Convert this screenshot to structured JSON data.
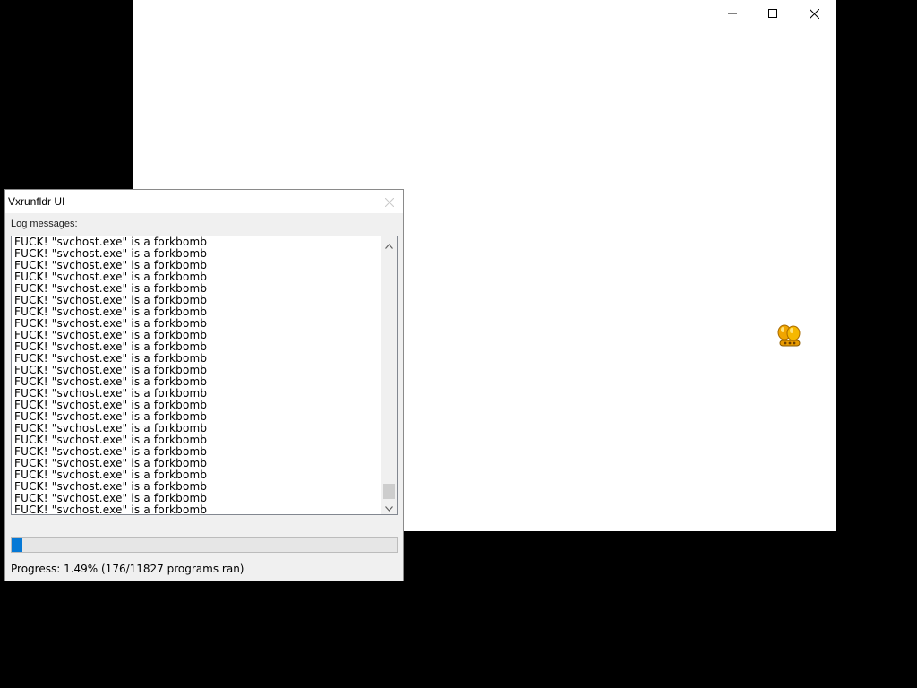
{
  "background_window": {
    "controls": {
      "minimize_icon": "minimize-icon",
      "maximize_icon": "maximize-icon",
      "close_icon": "close-icon"
    },
    "app_icon": "gold-bells-icon"
  },
  "vx_window": {
    "title": "Vxrunfldr UI",
    "close_icon": "close-icon",
    "log_label": "Log messages:",
    "log_lines": [
      "FUCK! \"svchost.exe\" is a forkbomb",
      "FUCK! \"svchost.exe\" is a forkbomb",
      "FUCK! \"svchost.exe\" is a forkbomb",
      "FUCK! \"svchost.exe\" is a forkbomb",
      "FUCK! \"svchost.exe\" is a forkbomb",
      "FUCK! \"svchost.exe\" is a forkbomb",
      "FUCK! \"svchost.exe\" is a forkbomb",
      "FUCK! \"svchost.exe\" is a forkbomb",
      "FUCK! \"svchost.exe\" is a forkbomb",
      "FUCK! \"svchost.exe\" is a forkbomb",
      "FUCK! \"svchost.exe\" is a forkbomb",
      "FUCK! \"svchost.exe\" is a forkbomb",
      "FUCK! \"svchost.exe\" is a forkbomb",
      "FUCK! \"svchost.exe\" is a forkbomb",
      "FUCK! \"svchost.exe\" is a forkbomb",
      "FUCK! \"svchost.exe\" is a forkbomb",
      "FUCK! \"svchost.exe\" is a forkbomb",
      "FUCK! \"svchost.exe\" is a forkbomb",
      "FUCK! \"svchost.exe\" is a forkbomb",
      "FUCK! \"svchost.exe\" is a forkbomb",
      "FUCK! \"svchost.exe\" is a forkbomb",
      "FUCK! \"svchost.exe\" is a forkbomb",
      "FUCK! \"svchost.exe\" is a forkbomb",
      "FUCK! \"svchost.exe\" is a forkbomb"
    ],
    "progress": {
      "fraction": 0.0149,
      "text": "Progress: 1.49% (176/11827 programs ran)"
    },
    "colors": {
      "progress_fill": "#0679d6",
      "window_bg": "#f0f0f0"
    }
  }
}
